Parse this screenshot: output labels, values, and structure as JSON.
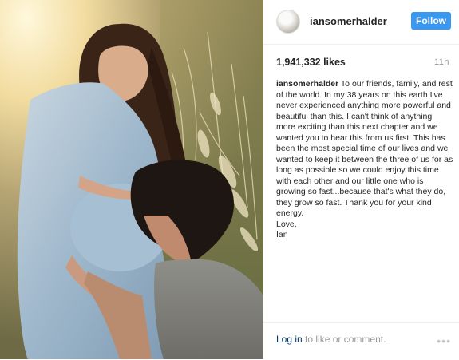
{
  "post": {
    "username": "iansomerhalder",
    "follow_label": "Follow",
    "likes": "1,941,332 likes",
    "time_ago": "11h",
    "caption_user": "iansomerhalder",
    "caption_text": " To our friends, family, and rest of the world. In my 38 years on this earth I've never experienced anything more powerful and beautiful than this. I can't think of anything more exciting than this next chapter and we wanted you to hear this from us first. This has been the most special time of our lives and we wanted to keep it between the three of us for as long as possible so we could enjoy this time with each other and our little one who is growing so fast...because that's what they do, they grow so fast. Thank you for your kind energy.\nLove,\nIan",
    "login_link": "Log in",
    "login_rest": " to like or comment.",
    "more_label": "•••"
  },
  "colors": {
    "follow_bg": "#3897f0",
    "link": "#003569",
    "muted": "#999999"
  },
  "icons": {
    "more": "more-options-icon",
    "avatar": "avatar"
  }
}
